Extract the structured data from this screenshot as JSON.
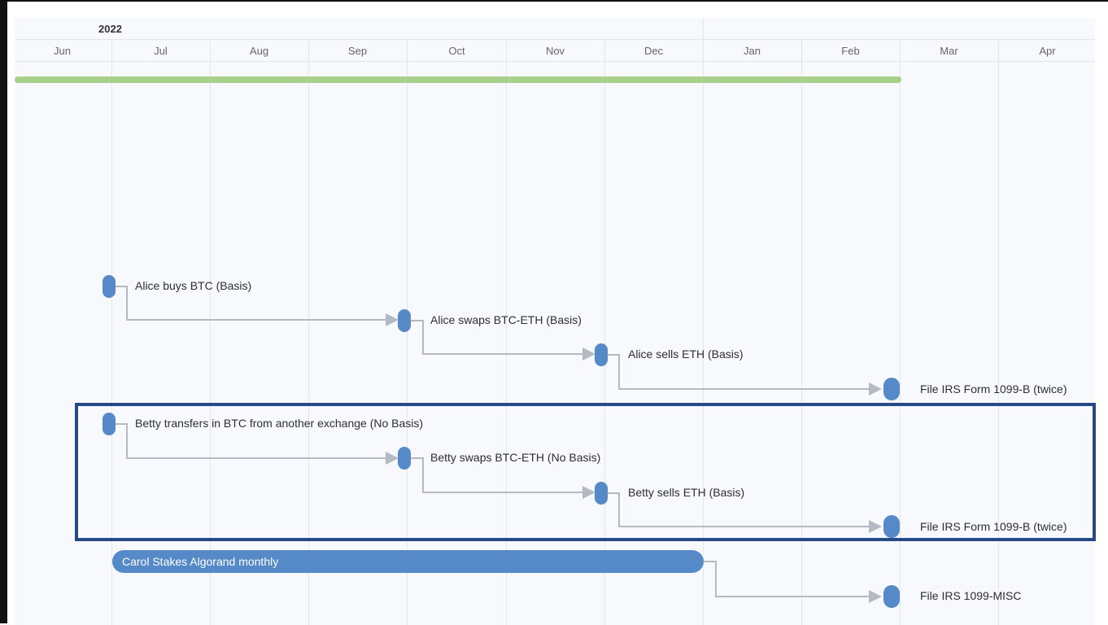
{
  "timeline": {
    "year": "2022",
    "months": [
      "Jun",
      "Jul",
      "Aug",
      "Sep",
      "Oct",
      "Nov",
      "Dec",
      "Jan",
      "Feb",
      "Mar",
      "Apr"
    ]
  },
  "colors": {
    "milestone": "#5589c7",
    "summary_bar": "#a8d08d",
    "highlight_border": "#244a87",
    "link_line": "#b4b9c2"
  },
  "tasks": [
    {
      "label": "Alice buys BTC (Basis)",
      "type": "milestone"
    },
    {
      "label": "Alice swaps BTC-ETH (Basis)",
      "type": "milestone"
    },
    {
      "label": "Alice sells ETH (Basis)",
      "type": "milestone"
    },
    {
      "label": "File IRS Form 1099-B (twice)",
      "type": "milestone"
    },
    {
      "label": "Betty transfers in BTC from another exchange (No Basis)",
      "type": "milestone"
    },
    {
      "label": "Betty swaps BTC-ETH (No Basis)",
      "type": "milestone"
    },
    {
      "label": "Betty sells ETH (Basis)",
      "type": "milestone"
    },
    {
      "label": "File IRS Form 1099-B (twice)",
      "type": "milestone"
    },
    {
      "label": "Carol Stakes Algorand monthly",
      "type": "span"
    },
    {
      "label": "File IRS 1099-MISC",
      "type": "milestone"
    }
  ]
}
